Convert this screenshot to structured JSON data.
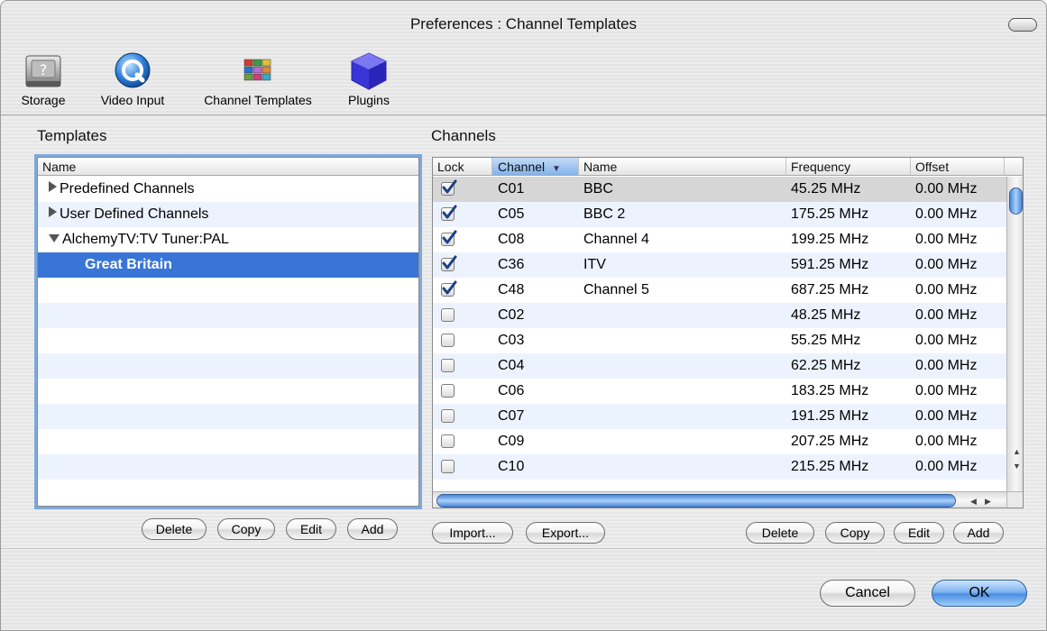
{
  "window": {
    "title": "Preferences : Channel Templates"
  },
  "toolbar": {
    "items": [
      {
        "label": "Storage",
        "icon": "hard-drive-icon"
      },
      {
        "label": "Video Input",
        "icon": "quicktime-icon"
      },
      {
        "label": "Channel Templates",
        "icon": "channel-grid-icon"
      },
      {
        "label": "Plugins",
        "icon": "cube-icon"
      }
    ]
  },
  "templates": {
    "title": "Templates",
    "column_header": "Name",
    "items": [
      {
        "label": "Predefined Channels",
        "expanded": false
      },
      {
        "label": "User Defined Channels",
        "expanded": false
      },
      {
        "label": "AlchemyTV:TV Tuner:PAL",
        "expanded": true
      },
      {
        "label": "Great Britain",
        "selected": true
      }
    ],
    "buttons": {
      "delete": "Delete",
      "copy": "Copy",
      "edit": "Edit",
      "add": "Add"
    }
  },
  "channels": {
    "title": "Channels",
    "columns": {
      "lock": "Lock",
      "channel": "Channel",
      "name": "Name",
      "frequency": "Frequency",
      "offset": "Offset"
    },
    "rows": [
      {
        "lock": true,
        "channel": "C01",
        "name": "BBC",
        "frequency": "45.25 MHz",
        "offset": "0.00 MHz"
      },
      {
        "lock": true,
        "channel": "C05",
        "name": "BBC 2",
        "frequency": "175.25 MHz",
        "offset": "0.00 MHz"
      },
      {
        "lock": true,
        "channel": "C08",
        "name": "Channel 4",
        "frequency": "199.25 MHz",
        "offset": "0.00 MHz"
      },
      {
        "lock": true,
        "channel": "C36",
        "name": "ITV",
        "frequency": "591.25 MHz",
        "offset": "0.00 MHz"
      },
      {
        "lock": true,
        "channel": "C48",
        "name": "Channel 5",
        "frequency": "687.25 MHz",
        "offset": "0.00 MHz"
      },
      {
        "lock": false,
        "channel": "C02",
        "name": "",
        "frequency": "48.25 MHz",
        "offset": "0.00 MHz"
      },
      {
        "lock": false,
        "channel": "C03",
        "name": "",
        "frequency": "55.25 MHz",
        "offset": "0.00 MHz"
      },
      {
        "lock": false,
        "channel": "C04",
        "name": "",
        "frequency": "62.25 MHz",
        "offset": "0.00 MHz"
      },
      {
        "lock": false,
        "channel": "C06",
        "name": "",
        "frequency": "183.25 MHz",
        "offset": "0.00 MHz"
      },
      {
        "lock": false,
        "channel": "C07",
        "name": "",
        "frequency": "191.25 MHz",
        "offset": "0.00 MHz"
      },
      {
        "lock": false,
        "channel": "C09",
        "name": "",
        "frequency": "207.25 MHz",
        "offset": "0.00 MHz"
      },
      {
        "lock": false,
        "channel": "C10",
        "name": "",
        "frequency": "215.25 MHz",
        "offset": "0.00 MHz"
      }
    ],
    "buttons": {
      "import": "Import...",
      "export": "Export...",
      "delete": "Delete",
      "copy": "Copy",
      "edit": "Edit",
      "add": "Add"
    }
  },
  "dialog": {
    "cancel": "Cancel",
    "ok": "OK"
  },
  "colors": {
    "selection": "#3875d7",
    "sort_header": "#83b3ea",
    "stripe": "#edf3fe"
  }
}
